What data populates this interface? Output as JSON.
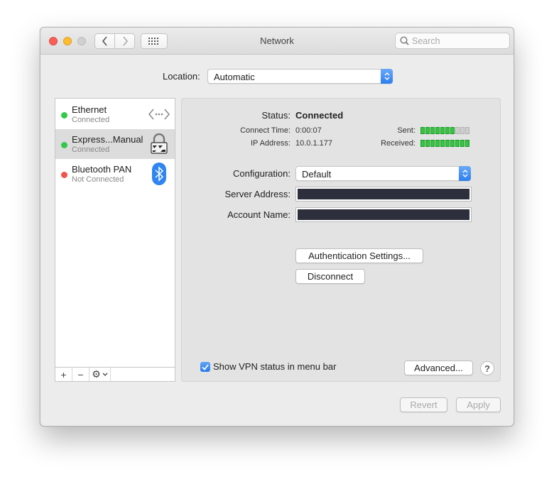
{
  "window": {
    "title": "Network"
  },
  "search": {
    "placeholder": "Search"
  },
  "location": {
    "label": "Location:",
    "value": "Automatic"
  },
  "services": [
    {
      "name": "Ethernet",
      "status": "Connected",
      "status_color": "#34c84a",
      "icon": "ethernet-icon"
    },
    {
      "name": "Express...Manual",
      "status": "Connected",
      "status_color": "#34c84a",
      "icon": "vpn-lock-icon"
    },
    {
      "name": "Bluetooth PAN",
      "status": "Not Connected",
      "status_color": "#f2544b",
      "icon": "bluetooth-icon"
    }
  ],
  "sidebar_tools": {
    "add": "+",
    "remove": "−",
    "gear": "⚙"
  },
  "detail": {
    "status_label": "Status:",
    "status_value": "Connected",
    "connect_time_label": "Connect Time:",
    "connect_time_value": "0:00:07",
    "ip_label": "IP Address:",
    "ip_value": "10.0.1.177",
    "sent_label": "Sent:",
    "sent_level": 7,
    "received_label": "Received:",
    "received_level": 10,
    "meter_segments": 10,
    "configuration_label": "Configuration:",
    "configuration_value": "Default",
    "server_address_label": "Server Address:",
    "account_name_label": "Account Name:",
    "auth_settings_button": "Authentication Settings...",
    "disconnect_button": "Disconnect",
    "show_vpn_label": "Show VPN status in menu bar",
    "show_vpn_checked": true,
    "advanced_button": "Advanced...",
    "help_button": "?"
  },
  "footer": {
    "revert": "Revert",
    "apply": "Apply"
  },
  "colors": {
    "accent": "#2b7ef0",
    "meter_on": "#35c640",
    "redacted": "#2d2f3d"
  }
}
